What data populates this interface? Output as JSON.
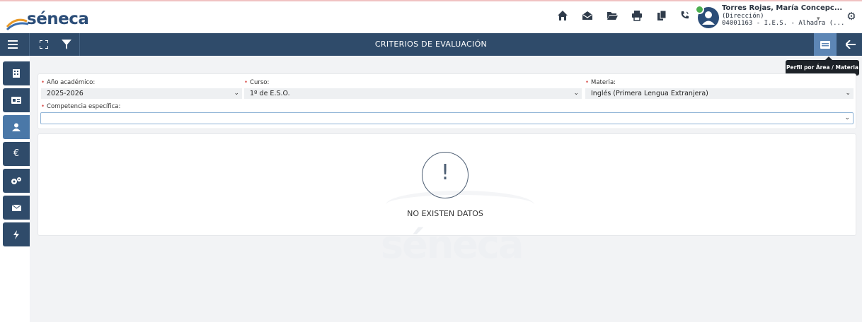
{
  "app": {
    "logo_text": "séneca",
    "watermark": "séneca"
  },
  "header": {
    "icons": [
      "home-icon",
      "inbox-icon",
      "folder-icon",
      "print-icon",
      "copy-icon",
      "phone-icon"
    ],
    "user": {
      "name": "Torres Rojas, María Concepc...",
      "role": "(Dirección)",
      "centro": "04001163 - I.E.S. - Alhadra (..."
    }
  },
  "navbar": {
    "title": "CRITERIOS DE EVALUACIÓN",
    "tooltip": "Perfil por Área / Materia"
  },
  "sidebar": {
    "items": [
      "building-icon",
      "id-card-icon",
      "users-icon",
      "euro-icon",
      "cogs-icon",
      "mail-icon",
      "bolt-icon"
    ],
    "active": "users-icon"
  },
  "filters": {
    "anio": {
      "label": "Año académico:",
      "value": "2025-2026"
    },
    "curso": {
      "label": "Curso:",
      "value": "1º de E.S.O."
    },
    "materia": {
      "label": "Materia:",
      "value": "Inglés (Primera Lengua Extranjera)"
    },
    "competencia": {
      "label": "Competencia específica:",
      "value": ""
    }
  },
  "result": {
    "empty_mark": "!",
    "empty_text": "NO EXISTEN DATOS"
  },
  "colors": {
    "primary": "#2f4b6a",
    "accent": "#4a78a8",
    "required": "#d9534f"
  }
}
